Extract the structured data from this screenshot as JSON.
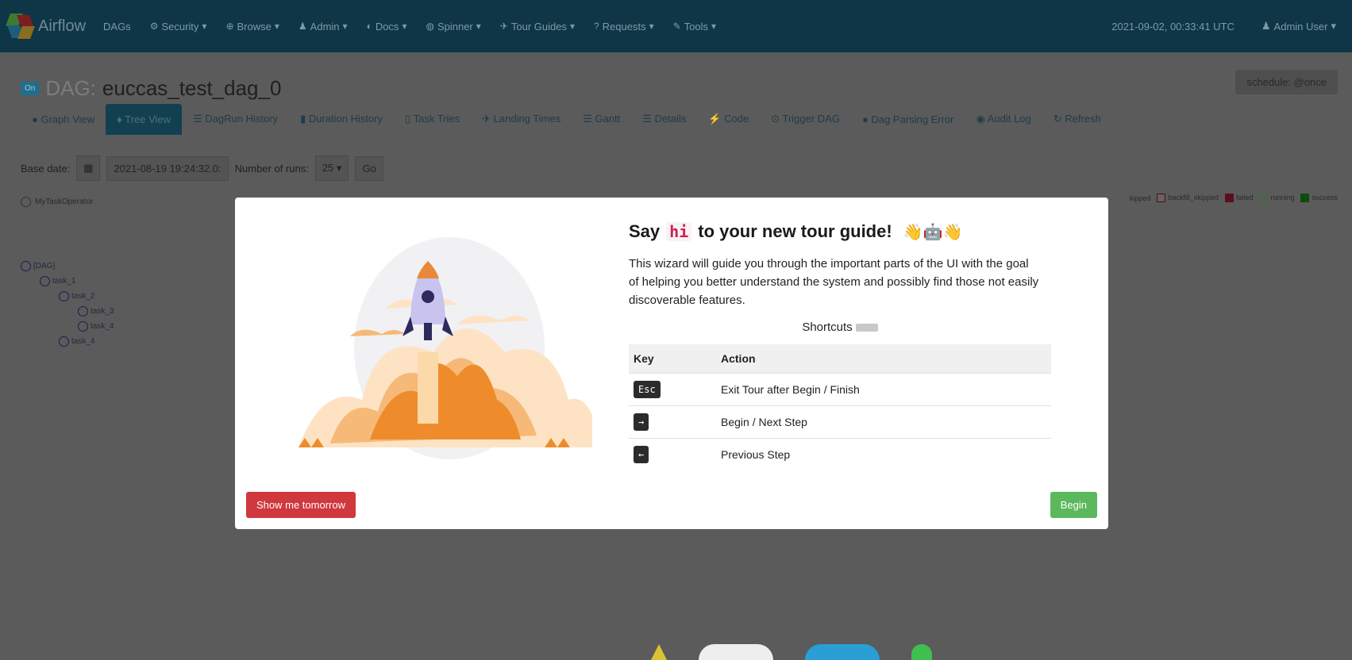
{
  "navbar": {
    "brand": "Airflow",
    "items": [
      {
        "label": "DAGs",
        "icon": ""
      },
      {
        "label": "Security",
        "icon": "⚙"
      },
      {
        "label": "Browse",
        "icon": "⊕"
      },
      {
        "label": "Admin",
        "icon": "♟"
      },
      {
        "label": "Docs",
        "icon": "◐"
      },
      {
        "label": "Spinner",
        "icon": "◍"
      },
      {
        "label": "Tour Guides",
        "icon": "✈"
      },
      {
        "label": "Requests",
        "icon": "?"
      },
      {
        "label": "Tools",
        "icon": "✎"
      }
    ],
    "timestamp": "2021-09-02, 00:33:41 UTC",
    "user": "Admin User"
  },
  "dag": {
    "toggle": "On",
    "label": "DAG:",
    "name": "euccas_test_dag_0",
    "schedule": "schedule: @once"
  },
  "tabs": [
    {
      "label": "Graph View",
      "icon": "●"
    },
    {
      "label": "Tree View",
      "icon": "♦"
    },
    {
      "label": "DagRun History",
      "icon": "☰"
    },
    {
      "label": "Duration History",
      "icon": "▮"
    },
    {
      "label": "Task Tries",
      "icon": "▯"
    },
    {
      "label": "Landing Times",
      "icon": "✈"
    },
    {
      "label": "Gantt",
      "icon": "☰"
    },
    {
      "label": "Details",
      "icon": "☰"
    },
    {
      "label": "Code",
      "icon": "⚡"
    },
    {
      "label": "Trigger DAG",
      "icon": "⊙"
    },
    {
      "label": "Dag Parsing Error",
      "icon": "●"
    },
    {
      "label": "Audit Log",
      "icon": "◉"
    },
    {
      "label": "Refresh",
      "icon": "↻"
    }
  ],
  "controls": {
    "base_date_label": "Base date:",
    "base_date_value": "2021-08-19 19:24:32.0:",
    "runs_label": "Number of runs:",
    "runs_value": "25",
    "go_label": "Go"
  },
  "tree": {
    "operator": "MyTaskOperator",
    "nodes": [
      "[DAG]",
      "task_1",
      "task_2",
      "task_3",
      "task_4",
      "task_4"
    ]
  },
  "legend": {
    "items": [
      "kipped",
      "backfill_skipped",
      "failed",
      "running",
      "success"
    ]
  },
  "modal": {
    "title_before": "Say",
    "title_code": "hi",
    "title_after": "to your new tour guide!",
    "emoji": "👋🤖👋",
    "description": "This wizard will guide you through the important parts of the UI with the goal of helping you better understand the system and possibly find those not easily discoverable features.",
    "shortcuts_label": "Shortcuts",
    "table_headers": [
      "Key",
      "Action"
    ],
    "shortcuts": [
      {
        "key": "Esc",
        "action": "Exit Tour after Begin / Finish"
      },
      {
        "key": "→",
        "action": "Begin / Next Step"
      },
      {
        "key": "←",
        "action": "Previous Step"
      }
    ],
    "btn_tomorrow": "Show me tomorrow",
    "btn_begin": "Begin"
  }
}
